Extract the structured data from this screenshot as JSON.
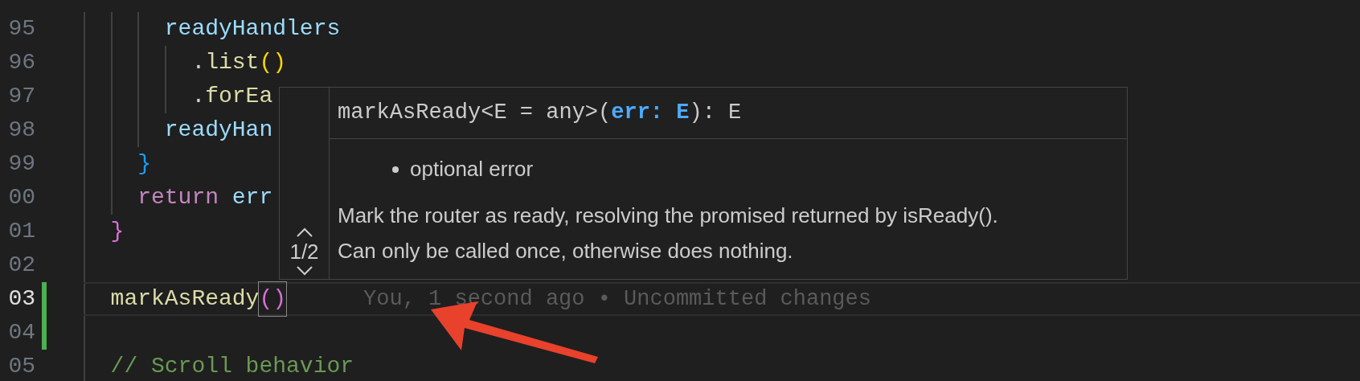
{
  "editor": {
    "lines": [
      {
        "number": "95",
        "modified": false,
        "current": false,
        "tokens": [
          {
            "text": "readyHandlers",
            "kind": "variable"
          }
        ]
      },
      {
        "number": "96",
        "modified": false,
        "current": false,
        "tokens": [
          {
            "text": ".",
            "kind": "plain"
          },
          {
            "text": "list",
            "kind": "function"
          },
          {
            "text": "()",
            "kind": "bracket-gold"
          }
        ]
      },
      {
        "number": "97",
        "modified": false,
        "current": false,
        "tokens": [
          {
            "text": ".",
            "kind": "plain"
          },
          {
            "text": "forEa",
            "kind": "function"
          }
        ]
      },
      {
        "number": "98",
        "modified": false,
        "current": false,
        "tokens": [
          {
            "text": "readyHan",
            "kind": "variable"
          }
        ]
      },
      {
        "number": "99",
        "modified": false,
        "current": false,
        "tokens": [
          {
            "text": "}",
            "kind": "bracket-blue"
          }
        ]
      },
      {
        "number": "00",
        "modified": false,
        "current": false,
        "tokens": [
          {
            "text": "return",
            "kind": "keyword"
          },
          {
            "text": "err",
            "kind": "variable"
          }
        ]
      },
      {
        "number": "01",
        "modified": false,
        "current": false,
        "tokens": [
          {
            "text": "}",
            "kind": "bracket-purple"
          }
        ]
      },
      {
        "number": "02",
        "modified": false,
        "current": false
      },
      {
        "number": "03",
        "modified": true,
        "current": true,
        "tokens": [
          {
            "text": "markAsReady",
            "kind": "function"
          },
          {
            "text": "()",
            "kind": "bracket-match"
          }
        ],
        "blame": "You, 1 second ago • Uncommitted changes"
      },
      {
        "number": "04",
        "modified": true,
        "current": false
      },
      {
        "number": "05",
        "modified": false,
        "current": false,
        "tokens": [
          {
            "text": "// Scroll behavior",
            "kind": "comment"
          }
        ]
      }
    ]
  },
  "signature_help": {
    "counter": "1/2",
    "signature": [
      {
        "text": "markAsReady<E = any>(",
        "active": false
      },
      {
        "text": "err: E",
        "active": true
      },
      {
        "text": "): E",
        "active": false
      }
    ],
    "parameter_docs": [
      "optional error"
    ],
    "description": "Mark the router as ready, resolving the promised returned by isReady(). Can only be called once, otherwise does nothing."
  }
}
